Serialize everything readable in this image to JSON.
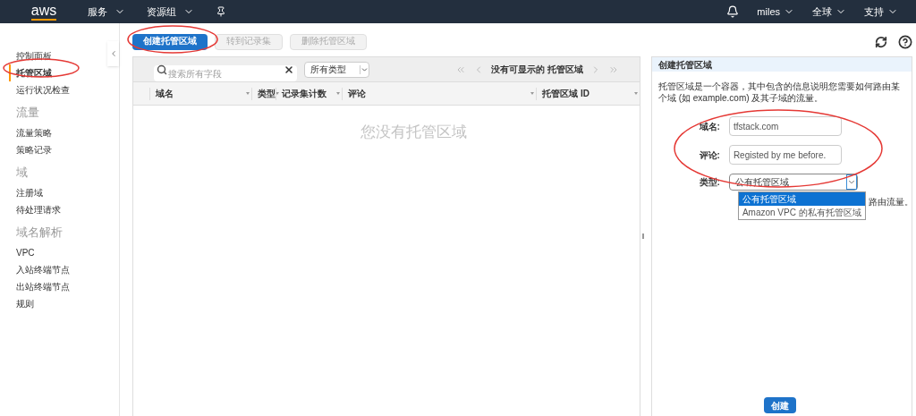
{
  "nav": {
    "logo": "aws",
    "menus": [
      {
        "label": "服务"
      },
      {
        "label": "资源组"
      }
    ],
    "user_menus": [
      {
        "label": "miles"
      },
      {
        "label": "全球"
      },
      {
        "label": "支持"
      }
    ]
  },
  "sidebar": {
    "items": [
      {
        "kind": "link",
        "label": "控制面板",
        "selected": false
      },
      {
        "kind": "link",
        "label": "托管区域",
        "selected": true
      },
      {
        "kind": "link",
        "label": "运行状况检查",
        "selected": false
      },
      {
        "kind": "heading",
        "label": "流量"
      },
      {
        "kind": "link",
        "label": "流量策略",
        "selected": false
      },
      {
        "kind": "link",
        "label": "策略记录",
        "selected": false
      },
      {
        "kind": "heading",
        "label": "域"
      },
      {
        "kind": "link",
        "label": "注册域",
        "selected": false
      },
      {
        "kind": "link",
        "label": "待处理请求",
        "selected": false
      },
      {
        "kind": "heading",
        "label": "域名解析"
      },
      {
        "kind": "link",
        "label": "VPC",
        "selected": false
      },
      {
        "kind": "link",
        "label": "入站终端节点",
        "selected": false
      },
      {
        "kind": "link",
        "label": "出站终端节点",
        "selected": false
      },
      {
        "kind": "link",
        "label": "规则",
        "selected": false
      }
    ]
  },
  "toolbar": {
    "buttons": [
      {
        "label": "创建托管区域",
        "disabled": false
      },
      {
        "label": "转到记录集",
        "disabled": true
      },
      {
        "label": "删除托管区域",
        "disabled": true
      }
    ]
  },
  "table": {
    "search": {
      "placeholder": "搜索所有字段"
    },
    "filter": {
      "value": "所有类型"
    },
    "pager": "没有可显示的 托管区域",
    "columns": [
      {
        "label": "域名"
      },
      {
        "label": "类型"
      },
      {
        "label": "记录集计数"
      },
      {
        "label": "评论"
      },
      {
        "label": "托管区域 ID"
      }
    ],
    "empty_message": "您没有托管区域"
  },
  "panel": {
    "title": "创建托管区域",
    "description": "托管区域是一个容器，其中包含的信息说明您需要如何路由某个域 (如 example.com) 及其子域的流量。",
    "fields": [
      {
        "label": "域名:",
        "value": "tfstack.com"
      },
      {
        "label": "评论:",
        "value": "Registed by me before."
      }
    ],
    "type": {
      "label": "类型:",
      "value": "公有托管区域",
      "expanded": true,
      "options": [
        {
          "label": "公有托管区域",
          "selected": true
        },
        {
          "label": "Amazon VPC 的私有托管区域",
          "selected": false
        }
      ]
    },
    "hidden_text": "路由流量。",
    "submit": "创建"
  }
}
